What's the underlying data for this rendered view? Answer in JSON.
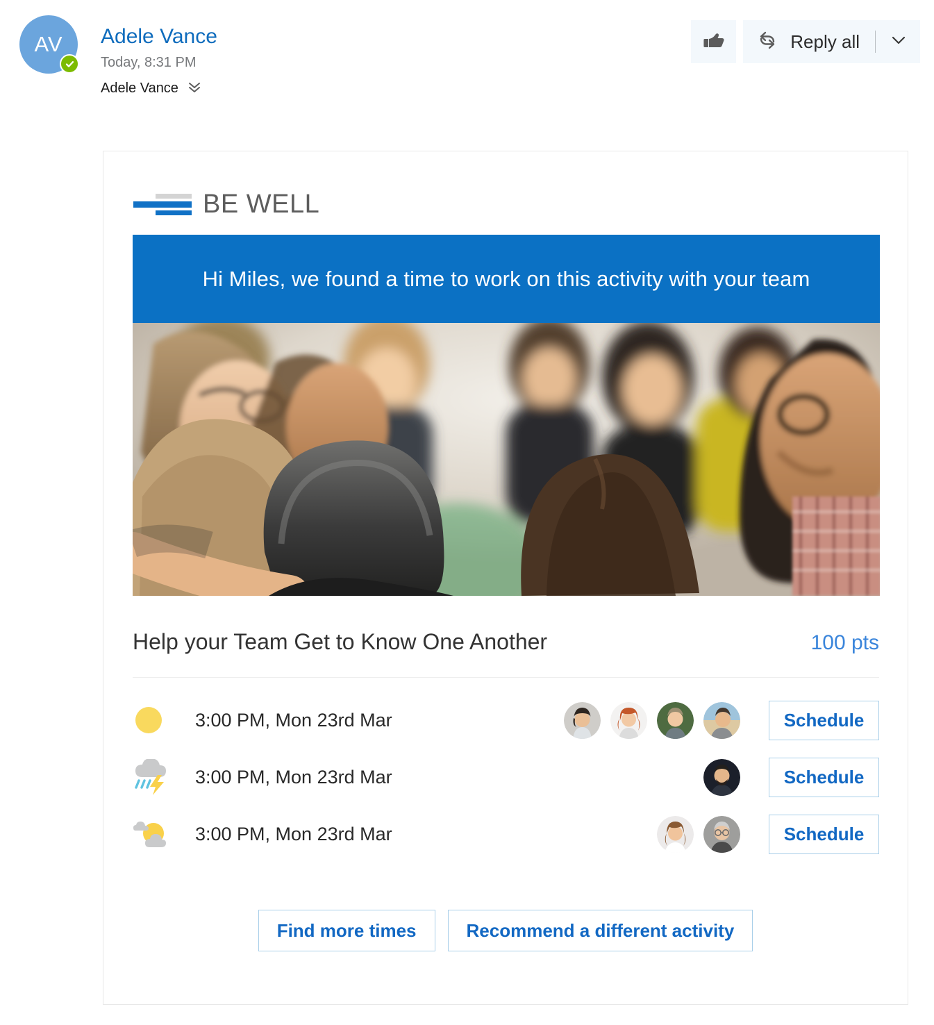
{
  "header": {
    "avatar_initials": "AV",
    "avatar_color": "#6ba5dd",
    "presence_color": "#7cbb00",
    "sender_name": "Adele Vance",
    "timestamp": "Today, 8:31 PM",
    "recipient": "Adele Vance",
    "expand_icon": "chevron-double-down-icon",
    "actions": {
      "like_icon": "thumbs-up-icon",
      "reply_all_icon": "reply-all-icon",
      "reply_all_label": "Reply all",
      "dropdown_icon": "chevron-down-icon"
    }
  },
  "card": {
    "logo_text": "BE WELL",
    "logo_bar_gray": "#d4d4d4",
    "logo_bar_blue": "#1071c6",
    "banner": {
      "text": "Hi Miles, we found a time to work on this activity with your team",
      "background": "#0b71c4",
      "text_color": "#ffffff"
    },
    "hero_image_alt": "group-of-people-embracing-in-a-circle",
    "activity_title": "Help your Team Get to Know One Another",
    "points": "100 pts",
    "points_color": "#3a85db",
    "slots": [
      {
        "weather_icon": "sunny-icon",
        "time": "3:00 PM, Mon 23rd Mar",
        "attendee_count": 4,
        "button_label": "Schedule"
      },
      {
        "weather_icon": "thunderstorm-icon",
        "time": "3:00 PM, Mon 23rd Mar",
        "attendee_count": 1,
        "button_label": "Schedule"
      },
      {
        "weather_icon": "partly-sunny-icon",
        "time": "3:00 PM, Mon 23rd Mar",
        "attendee_count": 2,
        "button_label": "Schedule"
      }
    ],
    "footer": {
      "find_more_times": "Find more times",
      "recommend_activity": "Recommend a different activity"
    },
    "accent_border": "#a9cfe9",
    "accent_text": "#1268c3"
  }
}
